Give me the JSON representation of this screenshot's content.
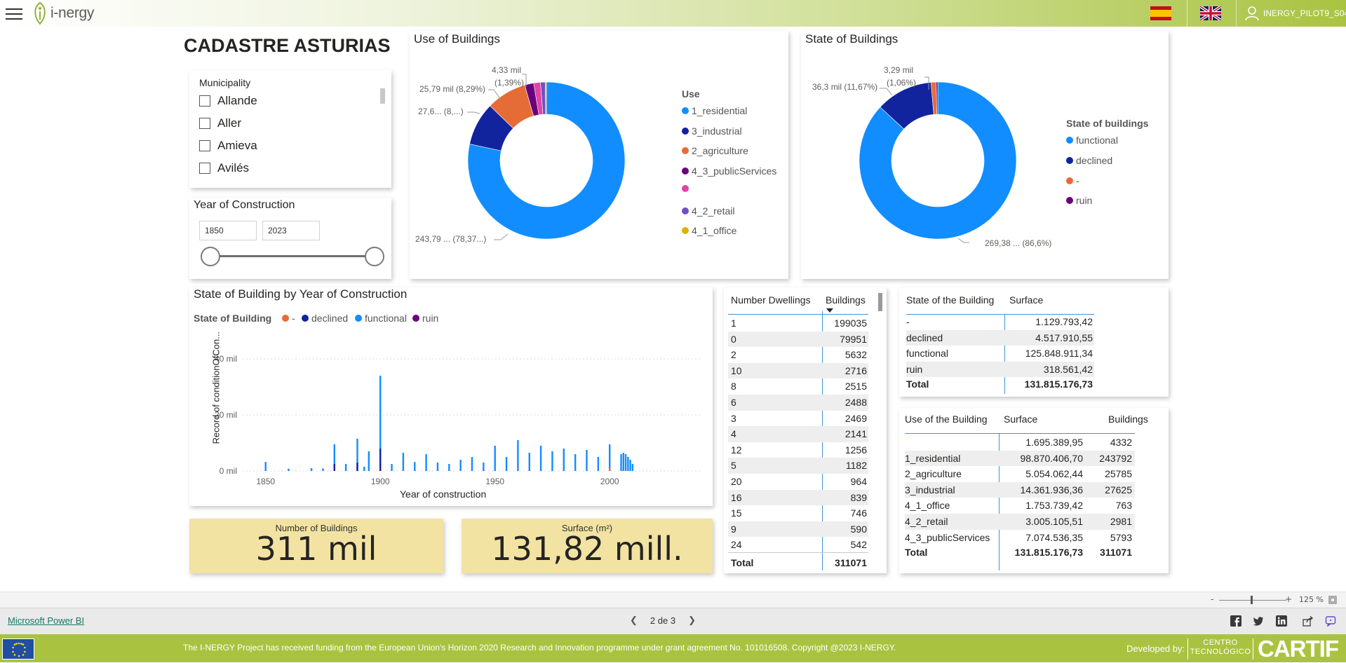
{
  "topbar": {
    "brand": "i-nergy",
    "user": "INERGY_PILOT9_S04"
  },
  "report": {
    "title": "CADASTRE ASTURIAS"
  },
  "municipality_slicer": {
    "title": "Municipality",
    "items": [
      "Allande",
      "Aller",
      "Amieva",
      "Avilés"
    ]
  },
  "year_slicer": {
    "title": "Year of Construction",
    "from": "1850",
    "to": "2023"
  },
  "use_chart": {
    "title": "Use of Buildings",
    "legend_title": "Use",
    "legend": [
      {
        "label": "1_residential",
        "color": "#118dff"
      },
      {
        "label": "3_industrial",
        "color": "#12239e"
      },
      {
        "label": "2_agriculture",
        "color": "#e66c37"
      },
      {
        "label": "4_3_publicServices",
        "color": "#6b007b"
      },
      {
        "label": "",
        "color": "#e044a7"
      },
      {
        "label": "4_2_retail",
        "color": "#744ec2"
      },
      {
        "label": "4_1_office",
        "color": "#d9b300"
      }
    ],
    "labels": {
      "l1": "4,33 mil",
      "l1b": "(1,39%)",
      "l2": "25,79 mil (8,29%)",
      "l3": "27,6... (8,...)",
      "l4": "243,79 ... (78,37...)"
    }
  },
  "state_chart": {
    "title": "State of Buildings",
    "legend_title": "State of buildings",
    "legend": [
      {
        "label": "functional",
        "color": "#118dff"
      },
      {
        "label": "declined",
        "color": "#12239e"
      },
      {
        "label": "-",
        "color": "#e66c37"
      },
      {
        "label": "ruin",
        "color": "#6b007b"
      }
    ],
    "labels": {
      "l1": "3,29 mil",
      "l1b": "(1,06%)",
      "l2": "36,3 mil (11,67%)",
      "l3": "269,38 ... (86,6%)"
    }
  },
  "bar_chart": {
    "title": "State of Building by Year of Construction",
    "legend_title": "State of Building",
    "legend": [
      {
        "label": "-",
        "color": "#e66c37"
      },
      {
        "label": "declined",
        "color": "#12239e"
      },
      {
        "label": "functional",
        "color": "#118dff"
      },
      {
        "label": "ruin",
        "color": "#6b007b"
      }
    ],
    "ylabel": "Record of conditionOfCon...",
    "xlabel": "Year of construction",
    "yticks": [
      "40 mil",
      "20 mil",
      "0 mil"
    ],
    "xticks": [
      "1850",
      "1900",
      "1950",
      "2000"
    ]
  },
  "chart_data": [
    {
      "type": "pie",
      "title": "Use of Buildings",
      "categories": [
        "1_residential",
        "3_industrial",
        "2_agriculture",
        "4_3_publicServices",
        "",
        "4_2_retail",
        "4_1_office"
      ],
      "values": [
        243792,
        27625,
        25785,
        5793,
        4332,
        2981,
        763
      ]
    },
    {
      "type": "pie",
      "title": "State of Buildings",
      "categories": [
        "functional",
        "declined",
        "-",
        "ruin"
      ],
      "values": [
        269380,
        36300,
        3290,
        1000
      ]
    },
    {
      "type": "bar",
      "title": "State of Building by Year of Construction",
      "xlabel": "Year of construction",
      "ylabel": "Record of conditionOfCon...",
      "xlim": [
        1840,
        2040
      ],
      "ylim": [
        0,
        45000
      ],
      "series": [
        {
          "name": "functional",
          "x": [
            1850,
            1860,
            1870,
            1875,
            1880,
            1885,
            1890,
            1893,
            1895,
            1900,
            1905,
            1910,
            1915,
            1920,
            1925,
            1930,
            1935,
            1940,
            1945,
            1950,
            1955,
            1960,
            1965,
            1970,
            1975,
            1980,
            1985,
            1990,
            1995,
            2000,
            2005,
            2006,
            2007,
            2008,
            2009,
            2010
          ],
          "values": [
            3200,
            800,
            1000,
            900,
            9500,
            2500,
            11500,
            1500,
            7000,
            34000,
            2500,
            6500,
            3200,
            6000,
            3000,
            2500,
            4000,
            5000,
            3000,
            9000,
            5000,
            11000,
            6500,
            9000,
            7000,
            8000,
            6000,
            7500,
            5000,
            9500,
            6000,
            6500,
            6000,
            5000,
            4000,
            2500
          ]
        },
        {
          "name": "declined",
          "x": [
            1880,
            1890,
            1900
          ],
          "values": [
            2500,
            3000,
            8000
          ]
        },
        {
          "name": "-",
          "x": [
            2000
          ],
          "values": [
            1000
          ]
        },
        {
          "name": "ruin",
          "x": [
            1900
          ],
          "values": [
            400
          ]
        }
      ]
    }
  ],
  "dwellings_table": {
    "headers": [
      "Number Dwellings",
      "Buildings"
    ],
    "rows": [
      [
        "1",
        "199035"
      ],
      [
        "0",
        "79951"
      ],
      [
        "2",
        "5632"
      ],
      [
        "10",
        "2716"
      ],
      [
        "8",
        "2515"
      ],
      [
        "6",
        "2488"
      ],
      [
        "3",
        "2469"
      ],
      [
        "4",
        "2141"
      ],
      [
        "12",
        "1256"
      ],
      [
        "5",
        "1182"
      ],
      [
        "20",
        "964"
      ],
      [
        "16",
        "839"
      ],
      [
        "15",
        "746"
      ],
      [
        "9",
        "590"
      ],
      [
        "24",
        "542"
      ]
    ],
    "total": [
      "Total",
      "311071"
    ]
  },
  "state_table": {
    "headers": [
      "State of the Building",
      "Surface"
    ],
    "rows": [
      [
        "-",
        "1.129.793,42"
      ],
      [
        "declined",
        "4.517.910,55"
      ],
      [
        "functional",
        "125.848.911,34"
      ],
      [
        "ruin",
        "318.561,42"
      ]
    ],
    "total": [
      "Total",
      "131.815.176,73"
    ]
  },
  "use_table": {
    "headers": [
      "Use of the Building",
      "Surface",
      "Buildings"
    ],
    "rows": [
      [
        "",
        "1.695.389,95",
        "4332"
      ],
      [
        "1_residential",
        "98.870.406,70",
        "243792"
      ],
      [
        "2_agriculture",
        "5.054.062,44",
        "25785"
      ],
      [
        "3_industrial",
        "14.361.936,36",
        "27625"
      ],
      [
        "4_1_office",
        "1.753.739,42",
        "763"
      ],
      [
        "4_2_retail",
        "3.005.105,51",
        "2981"
      ],
      [
        "4_3_publicServices",
        "7.074.536,35",
        "5793"
      ]
    ],
    "total": [
      "Total",
      "131.815.176,73",
      "311071"
    ]
  },
  "cards": {
    "buildings_label": "Number of Buildings",
    "buildings_value": "311 mil",
    "surface_label": "Surface (m²)",
    "surface_value": "131,82 mill."
  },
  "zoom": {
    "minus": "-",
    "plus": "+",
    "level": "125 %"
  },
  "nav": {
    "powerbi_link": "Microsoft Power BI",
    "page": "2 de 3"
  },
  "footer": {
    "text": "The I-NERGY Project has received funding from the European Union's Horizon 2020 Research and Innovation programme under grant agreement No. 101016508. Copyright @2023 I-NERGY.",
    "developed_by": "Developed by:",
    "centro_line1": "CENTRO",
    "centro_line2": "TECNOLÓGICO",
    "cartif": "CARTIF"
  },
  "colors": {
    "accent_green": "#a9c341",
    "card_yellow": "#f2e3a2",
    "table_blue": "#3a96dd"
  }
}
